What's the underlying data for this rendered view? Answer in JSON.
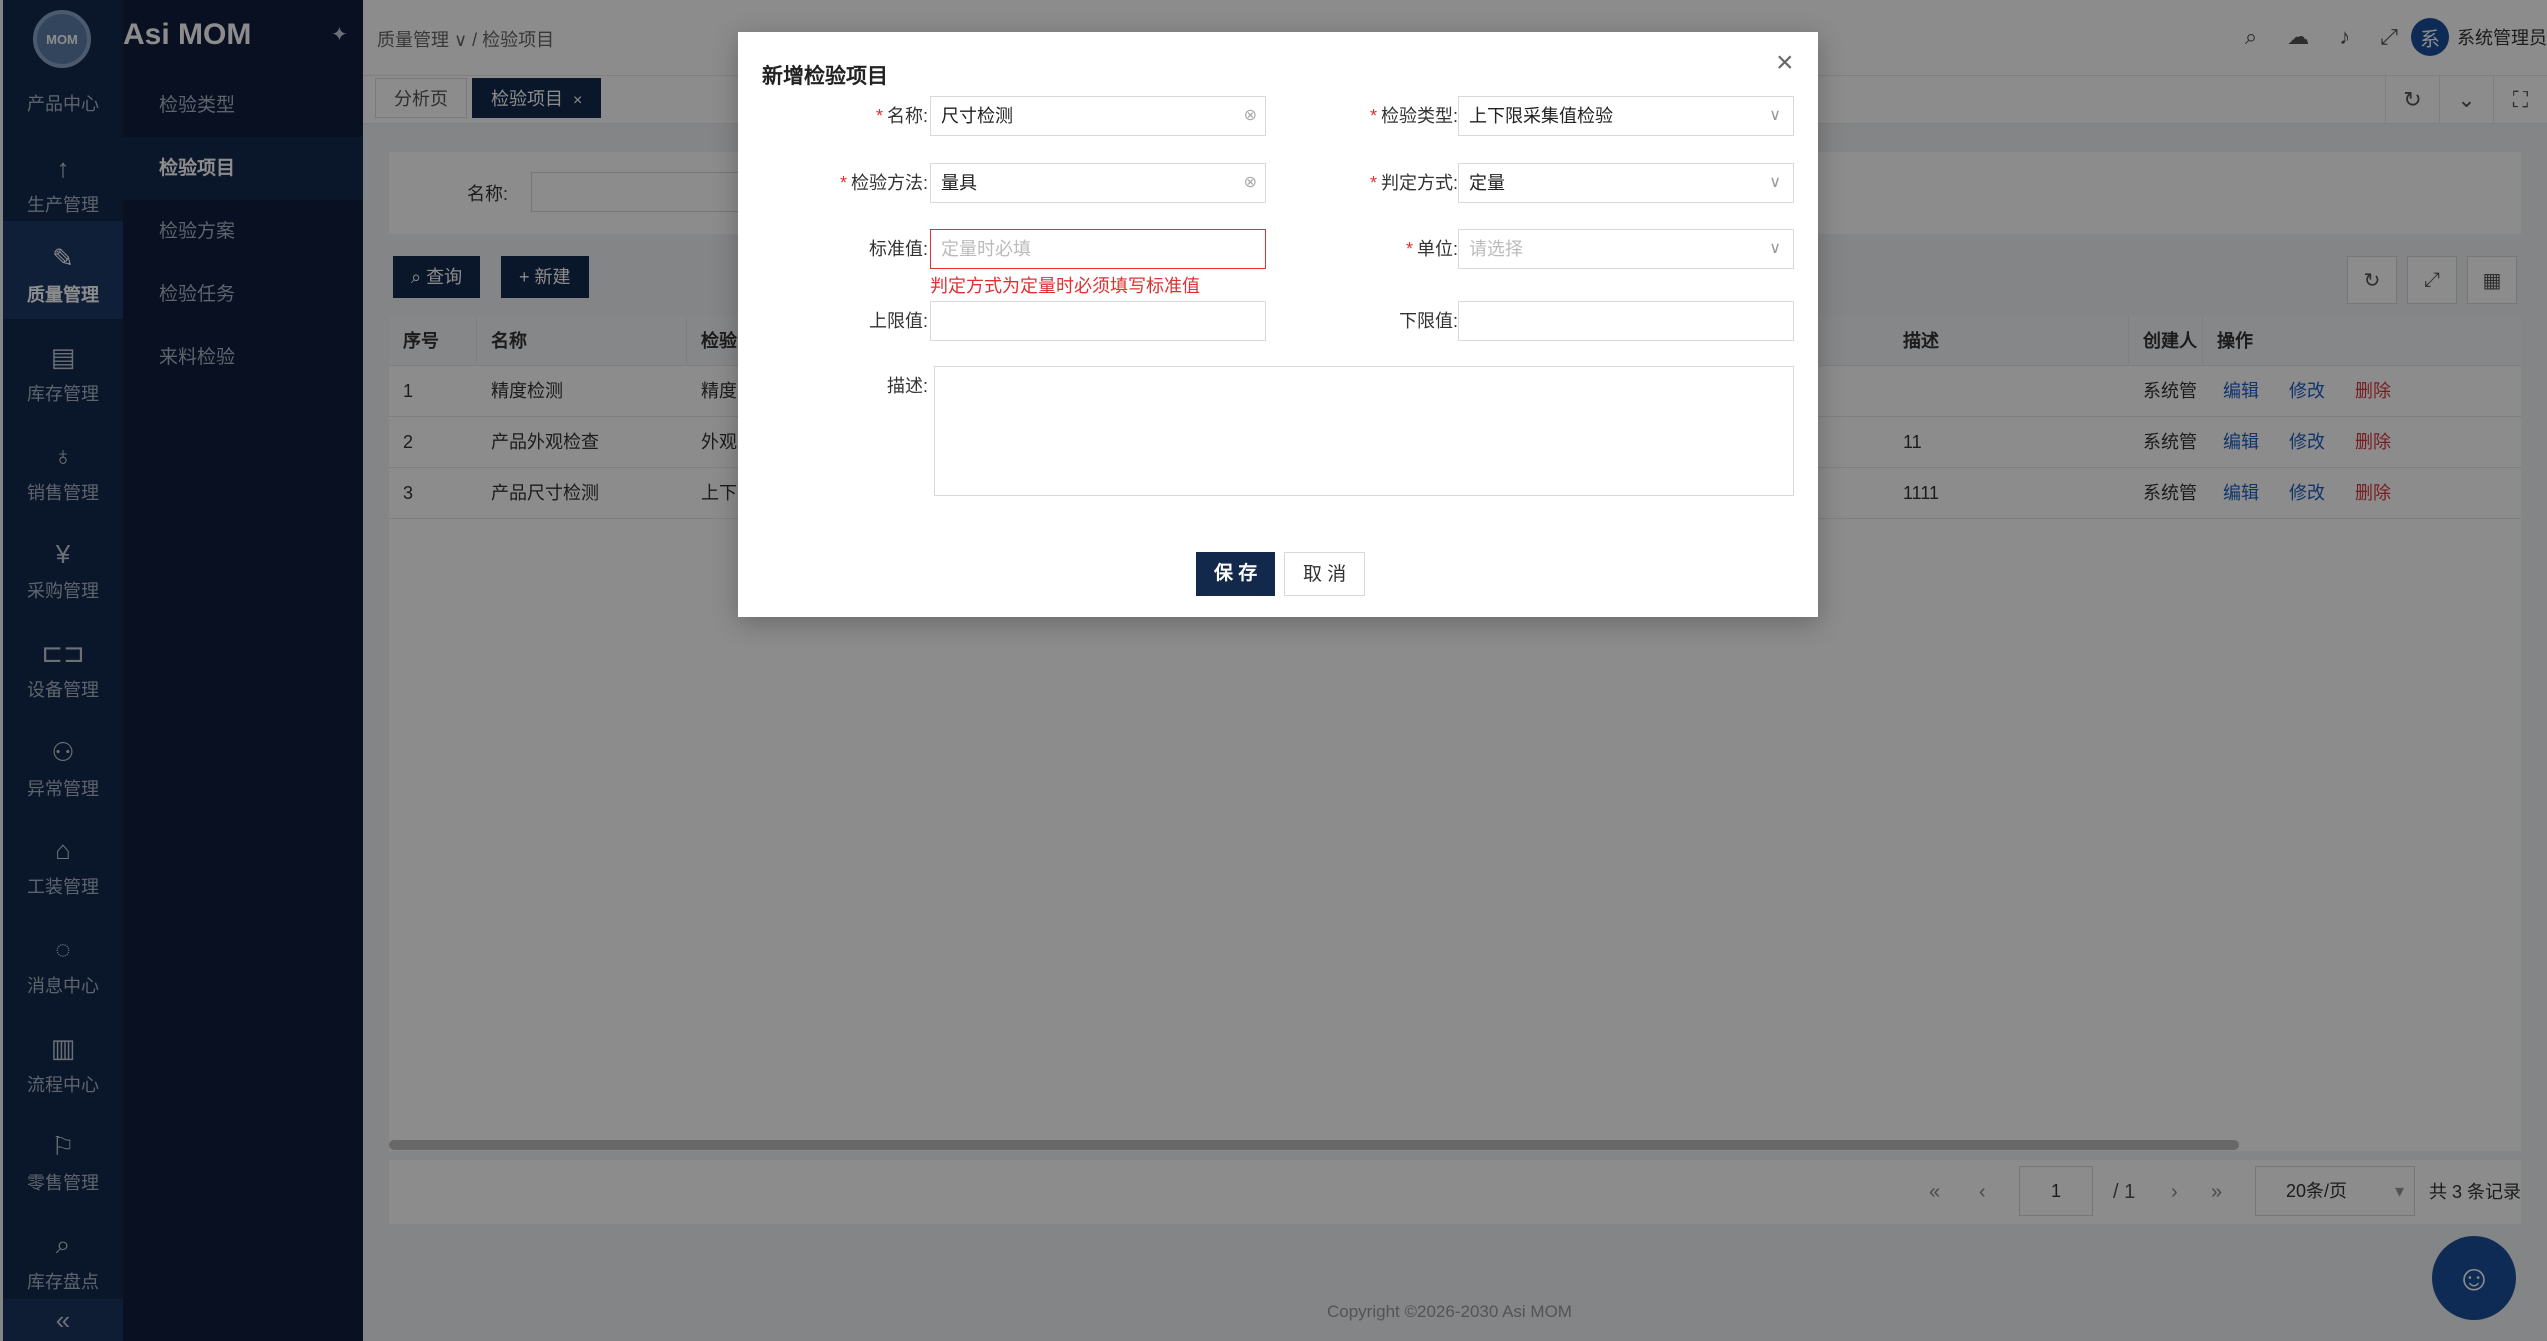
{
  "app": {
    "brand": "Asi MOM",
    "logo_text": "MOM"
  },
  "rail": {
    "items": [
      {
        "label": "产品中心",
        "icon": "product-icon"
      },
      {
        "label": "生产管理",
        "icon": "arrow-up-icon"
      },
      {
        "label": "质量管理",
        "icon": "quality-icon",
        "active": true
      },
      {
        "label": "库存管理",
        "icon": "inventory-icon"
      },
      {
        "label": "销售管理",
        "icon": "sales-icon"
      },
      {
        "label": "采购管理",
        "icon": "purchase-icon"
      },
      {
        "label": "设备管理",
        "icon": "device-icon"
      },
      {
        "label": "异常管理",
        "icon": "exception-icon"
      },
      {
        "label": "工装管理",
        "icon": "tooling-icon"
      },
      {
        "label": "消息中心",
        "icon": "message-icon"
      },
      {
        "label": "流程中心",
        "icon": "workflow-icon"
      },
      {
        "label": "零售管理",
        "icon": "retail-icon"
      },
      {
        "label": "库存盘点",
        "icon": "stocktake-icon"
      }
    ],
    "collapse": "«"
  },
  "submenu": {
    "items": [
      {
        "label": "检验类型"
      },
      {
        "label": "检验项目",
        "active": true
      },
      {
        "label": "检验方案"
      },
      {
        "label": "检验任务"
      },
      {
        "label": "来料检验"
      }
    ]
  },
  "header": {
    "breadcrumb": "质量管理 ∨ / 检验项目",
    "user_avatar": "系",
    "user_name": "系统管理员"
  },
  "tabs": [
    {
      "label": "分析页"
    },
    {
      "label": "检验项目",
      "active": true,
      "close": "×"
    }
  ],
  "search": {
    "name_label": "名称:"
  },
  "toolbar": {
    "query_label": "查询",
    "new_label": "+ 新建"
  },
  "table": {
    "headers": [
      "序号",
      "名称",
      "检验",
      "描述",
      "创建人",
      "操作"
    ],
    "rows": [
      {
        "index": "1",
        "name": "精度检测",
        "method": "精度",
        "desc": "",
        "creator": "系统管"
      },
      {
        "index": "2",
        "name": "产品外观检查",
        "method": "外观",
        "desc": "11",
        "creator": "系统管"
      },
      {
        "index": "3",
        "name": "产品尺寸检测",
        "method": "上下",
        "desc": "1111",
        "creator": "系统管"
      }
    ],
    "actions": {
      "edit": "编辑",
      "modify": "修改",
      "delete": "删除"
    }
  },
  "pager": {
    "current": "1",
    "total_pages": "/ 1",
    "page_size": "20条/页",
    "total": "共 3 条记录"
  },
  "copyright": "Copyright ©2026-2030 Asi MOM",
  "modal": {
    "title": "新增检验项目",
    "name_label": "名称:",
    "name_value": "尺寸检测",
    "type_label": "检验类型:",
    "type_value": "上下限采集值检验",
    "method_label": "检验方法:",
    "method_value": "量具",
    "judge_label": "判定方式:",
    "judge_value": "定量",
    "std_label": "标准值:",
    "std_placeholder": "定量时必填",
    "std_error": "判定方式为定量时必须填写标准值",
    "unit_label": "单位:",
    "unit_placeholder": "请选择",
    "upper_label": "上限值:",
    "lower_label": "下限值:",
    "desc_label": "描述:",
    "save": "保 存",
    "cancel": "取 消"
  }
}
